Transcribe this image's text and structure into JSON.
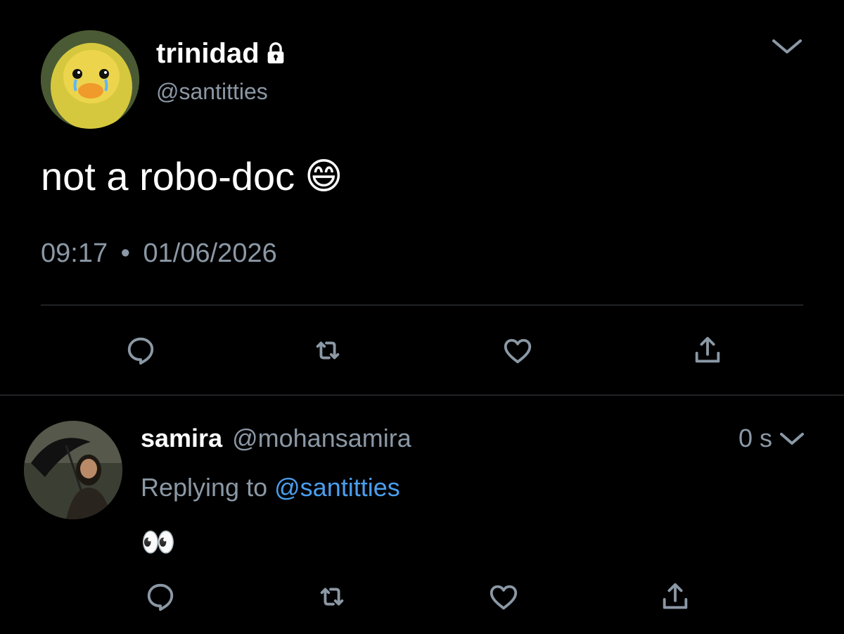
{
  "main_tweet": {
    "display_name": "trinidad",
    "handle": "@santitties",
    "text": "not a robo-doc",
    "emoji": "😄",
    "time": "09:17",
    "separator": "•",
    "date": "01/06/2026",
    "avatar_icon": "duckling-avatar",
    "protected_icon": "lock-icon"
  },
  "reply_tweet": {
    "display_name": "samira",
    "handle": "@mohansamira",
    "time": "0 s",
    "replying_prefix": "Replying to",
    "replying_handle": "@santitties",
    "text": "👀",
    "avatar_icon": "person-with-umbrella-avatar"
  },
  "colors": {
    "background": "#000000",
    "text": "#ffffff",
    "secondary_text": "#8b98a5",
    "link": "#4a9eed",
    "divider": "#3d4146",
    "icon": "#8b98a5"
  },
  "actions": [
    "reply-icon",
    "retweet-icon",
    "like-icon",
    "share-icon"
  ]
}
